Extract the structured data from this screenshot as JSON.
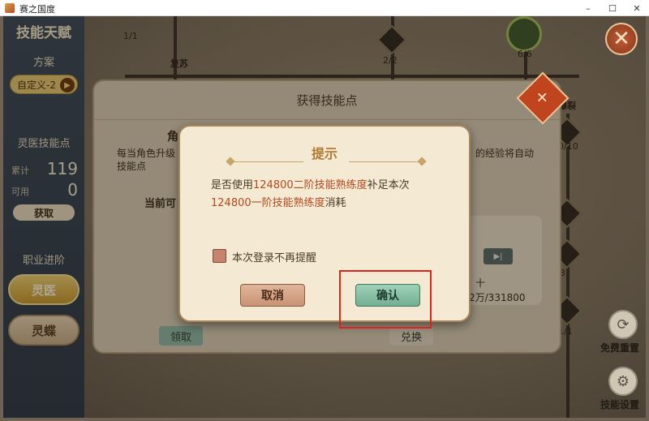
{
  "window": {
    "title": "赛之国度",
    "min": "–",
    "max": "☐",
    "close": "✕"
  },
  "sidebar": {
    "title": "技能天赋",
    "plan_heading": "方案",
    "plan_value": "自定义-2",
    "points_heading": "灵医技能点",
    "total_label": "累计",
    "total_value": "119",
    "available_label": "可用",
    "available_value": "0",
    "get_button": "获取",
    "advance_heading": "职业进阶",
    "class_primary": "灵医",
    "class_secondary": "灵蝶"
  },
  "map": {
    "node_labels": [
      "1/1",
      "复苏",
      "2/2",
      "6/6",
      "爆裂",
      "0/10",
      "3",
      "3",
      "1/1"
    ]
  },
  "bg_dialog": {
    "title": "获得技能点",
    "intro_left": "每当角色升级",
    "intro_left2": "技能点",
    "intro_right": "的经验将自动",
    "partial_label": "角",
    "current_label": "当前可",
    "progress_text": "2万/331800",
    "count_fragment": "十",
    "btn_left": "领取",
    "btn_right": "兑换"
  },
  "modal": {
    "title": "提示",
    "msg_prefix": "是否使用",
    "msg_hl1": "124800二阶技能熟练度",
    "msg_mid": "补足本次",
    "msg_hl2": "124800一阶技能熟练度",
    "msg_suffix": "消耗",
    "checkbox_label": "本次登录不再提醒",
    "cancel": "取消",
    "confirm": "确认"
  },
  "tools": {
    "reset_label": "免费重置",
    "settings_label": "技能设置"
  },
  "colors": {
    "accent_title": "#b07a32",
    "highlight": "#b0481e",
    "confirm_green": "#74ae92",
    "cancel_brown": "#c99376",
    "annotation_red": "#d8241e"
  }
}
